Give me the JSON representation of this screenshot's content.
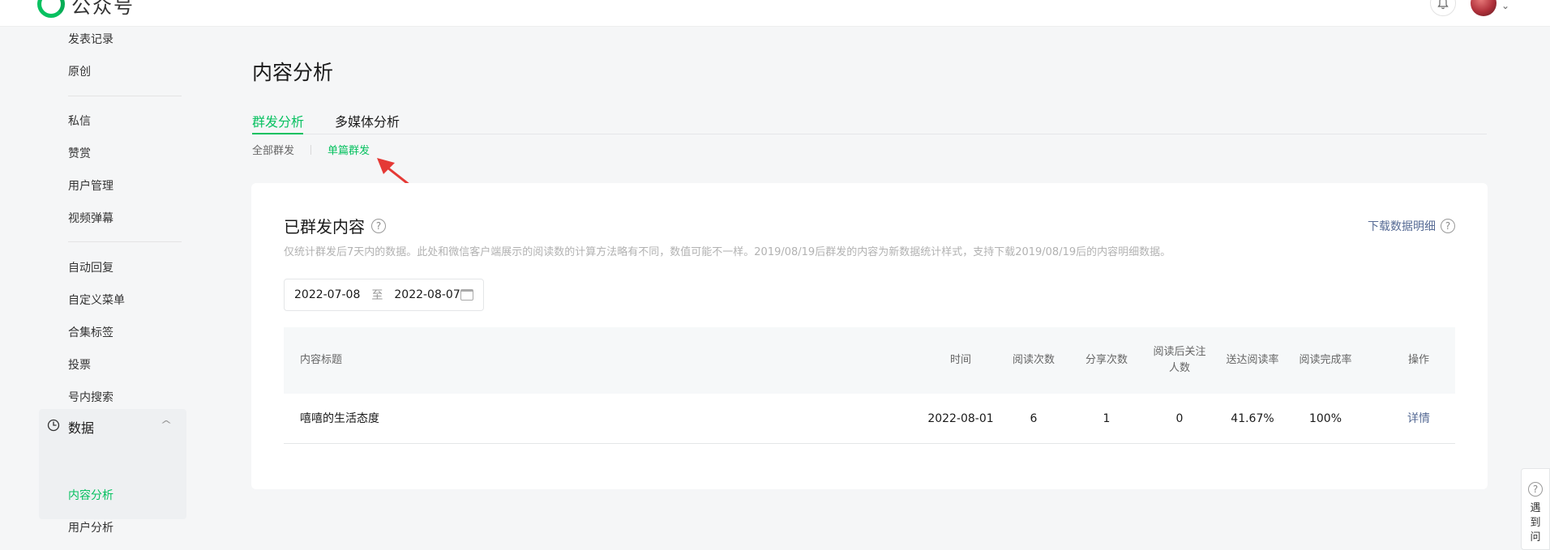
{
  "topbar": {
    "brand": "公众号"
  },
  "sidebar": {
    "items_top": [
      {
        "label": "发表记录"
      },
      {
        "label": "原创"
      }
    ],
    "items_mid": [
      {
        "label": "私信"
      },
      {
        "label": "赞赏"
      },
      {
        "label": "用户管理"
      },
      {
        "label": "视频弹幕"
      }
    ],
    "items_func": [
      {
        "label": "自动回复"
      },
      {
        "label": "自定义菜单"
      },
      {
        "label": "合集标签"
      },
      {
        "label": "投票"
      },
      {
        "label": "号内搜索"
      }
    ],
    "section": {
      "label": "数据",
      "items": [
        {
          "label": "内容分析",
          "active": true
        },
        {
          "label": "用户分析"
        }
      ]
    }
  },
  "page": {
    "title": "内容分析"
  },
  "tabs": [
    {
      "label": "群发分析",
      "active": true
    },
    {
      "label": "多媒体分析"
    }
  ],
  "subtabs": [
    {
      "label": "全部群发"
    },
    {
      "label": "单篇群发",
      "active": true
    }
  ],
  "card": {
    "title": "已群发内容",
    "download_label": "下载数据明细",
    "description": "仅统计群发后7天内的数据。此处和微信客户端展示的阅读数的计算方法略有不同，数值可能不一样。2019/08/19后群发的内容为新数据统计样式，支持下载2019/08/19后的内容明细数据。",
    "date_range": {
      "start": "2022-07-08",
      "separator": "至",
      "end": "2022-08-07"
    }
  },
  "table": {
    "headers": {
      "title": "内容标题",
      "time": "时间",
      "reads": "阅读次数",
      "shares": "分享次数",
      "follows_line1": "阅读后关注",
      "follows_line2": "人数",
      "delivery_rate": "送达阅读率",
      "completion_rate": "阅读完成率",
      "action": "操作"
    },
    "rows": [
      {
        "title": "嘻嘻的生活态度",
        "time": "2022-08-01",
        "reads": "6",
        "shares": "1",
        "follows": "0",
        "delivery_rate": "41.67%",
        "completion_rate": "100%",
        "action": "详情"
      }
    ]
  },
  "float_help": {
    "chars": [
      "遇",
      "到",
      "问"
    ]
  },
  "colors": {
    "accent": "#07c160",
    "link": "#576b95",
    "annotation_arrow": "#e53935"
  },
  "icons": {
    "brand": "wechat-logo-icon",
    "bell": "bell-icon",
    "data_section": "chart-clock-icon",
    "help": "question-circle-icon",
    "calendar": "calendar-icon",
    "annotation": "red-arrow-icon"
  }
}
